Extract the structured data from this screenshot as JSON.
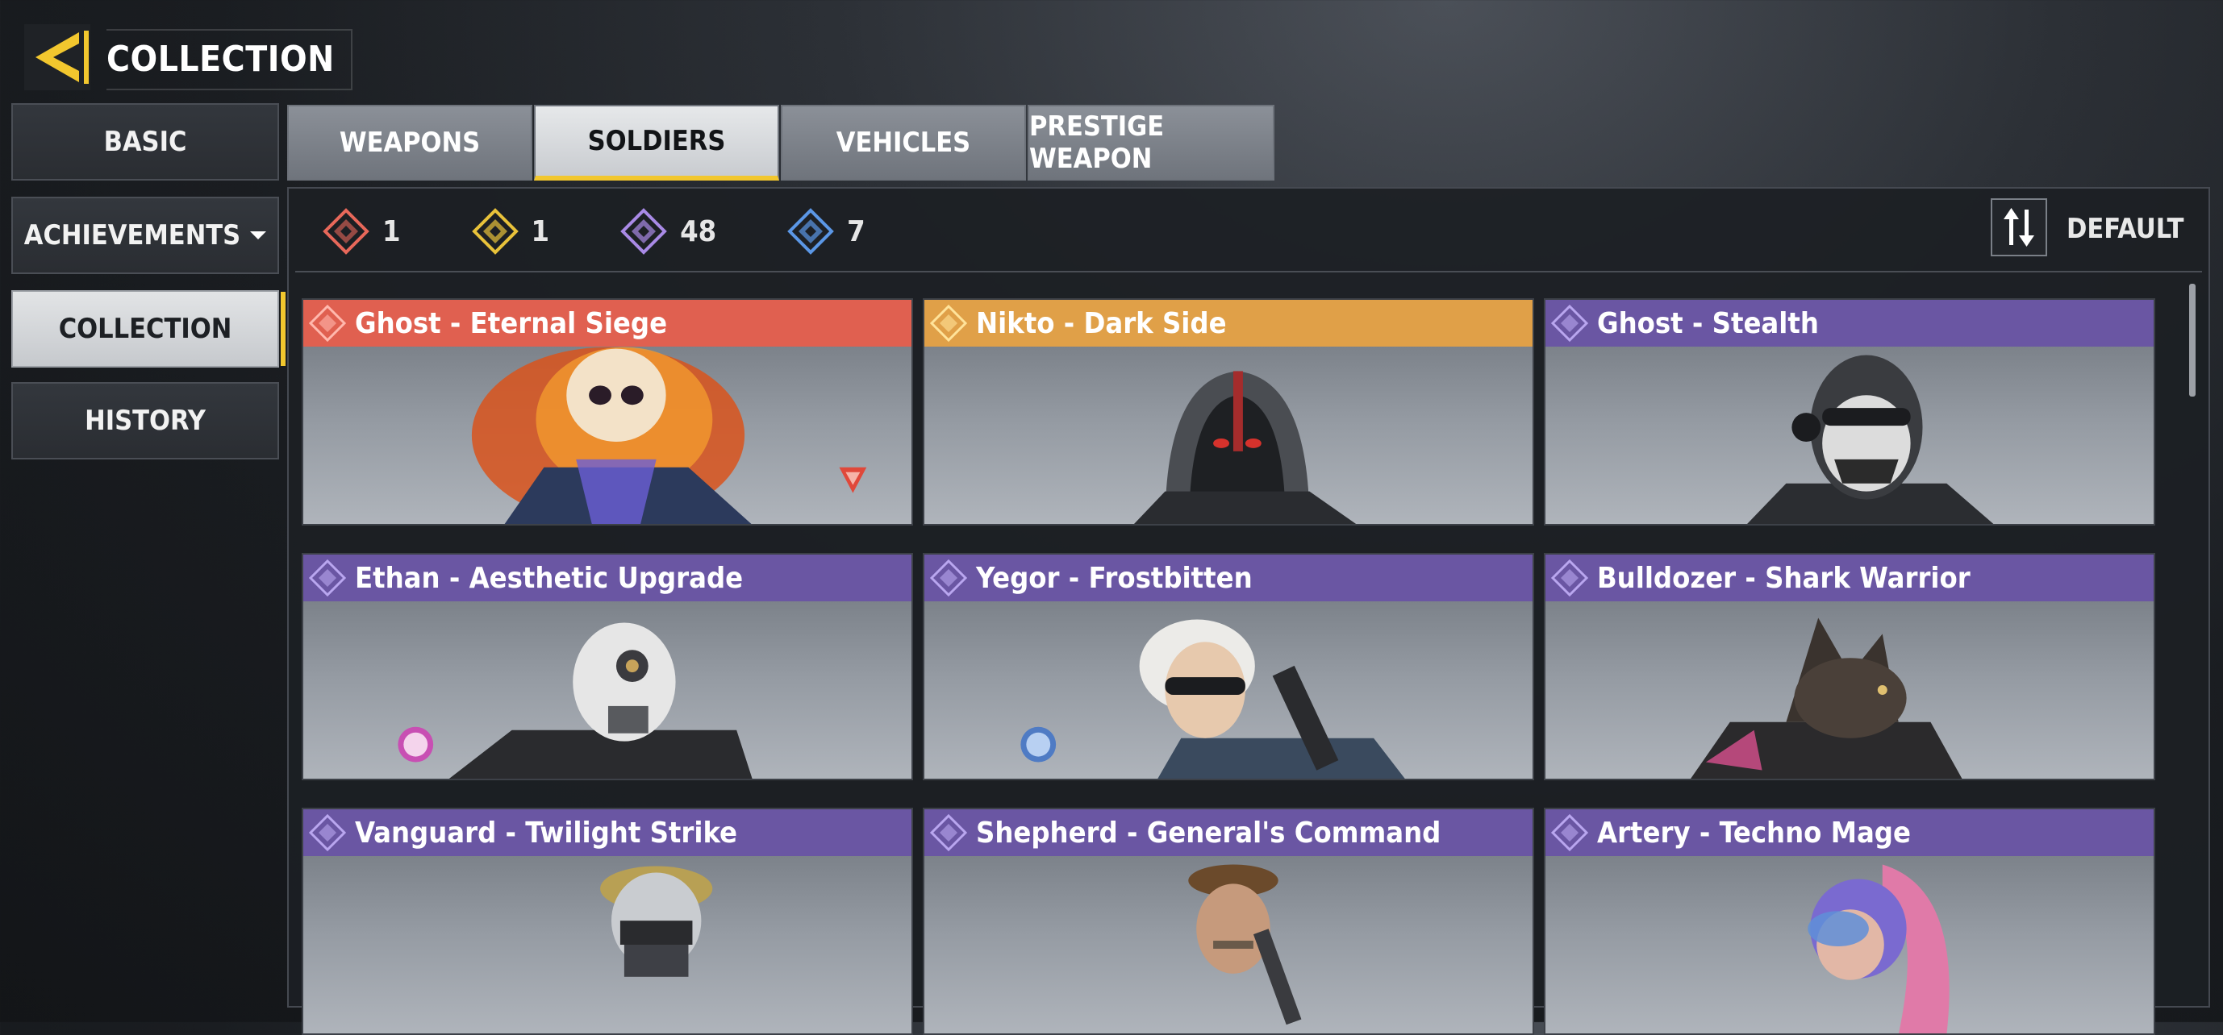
{
  "header": {
    "title": "COLLECTION",
    "back_icon": "back-arrow-icon"
  },
  "sidebar": {
    "items": [
      {
        "label": "BASIC",
        "active": false
      },
      {
        "label": "ACHIEVEMENTS",
        "active": false,
        "has_dropdown": true
      },
      {
        "label": "COLLECTION",
        "active": true
      },
      {
        "label": "HISTORY",
        "active": false
      }
    ]
  },
  "tabs": [
    {
      "label": "WEAPONS",
      "active": false
    },
    {
      "label": "SOLDIERS",
      "active": true
    },
    {
      "label": "VEHICLES",
      "active": false
    },
    {
      "label": "PRESTIGE WEAPON",
      "active": false
    }
  ],
  "rarity_summary": [
    {
      "icon": "mythic-diamond-icon",
      "color": "#e8685a",
      "count": "1"
    },
    {
      "icon": "legendary-diamond-icon",
      "color": "#e8c23a",
      "count": "1"
    },
    {
      "icon": "epic-diamond-icon",
      "color": "#a98ae6",
      "count": "48"
    },
    {
      "icon": "rare-diamond-icon",
      "color": "#5b97e6",
      "count": "7"
    }
  ],
  "sort": {
    "label": "DEFAULT",
    "icon": "sort-arrows-icon"
  },
  "colors": {
    "mythic": "#e06050",
    "legendary": "#e0a048",
    "epic": "#6a56a3",
    "accent": "#f2c72e"
  },
  "cards": [
    {
      "title": "Ghost - Eternal Siege",
      "rarity": "mythic"
    },
    {
      "title": "Nikto - Dark Side",
      "rarity": "legendary"
    },
    {
      "title": "Ghost - Stealth",
      "rarity": "epic"
    },
    {
      "title": "Ethan - Aesthetic Upgrade",
      "rarity": "epic"
    },
    {
      "title": "Yegor - Frostbitten",
      "rarity": "epic"
    },
    {
      "title": "Bulldozer - Shark Warrior",
      "rarity": "epic"
    },
    {
      "title": "Vanguard - Twilight Strike",
      "rarity": "epic"
    },
    {
      "title": "Shepherd - General's Command",
      "rarity": "epic"
    },
    {
      "title": "Artery - Techno Mage",
      "rarity": "epic"
    }
  ]
}
